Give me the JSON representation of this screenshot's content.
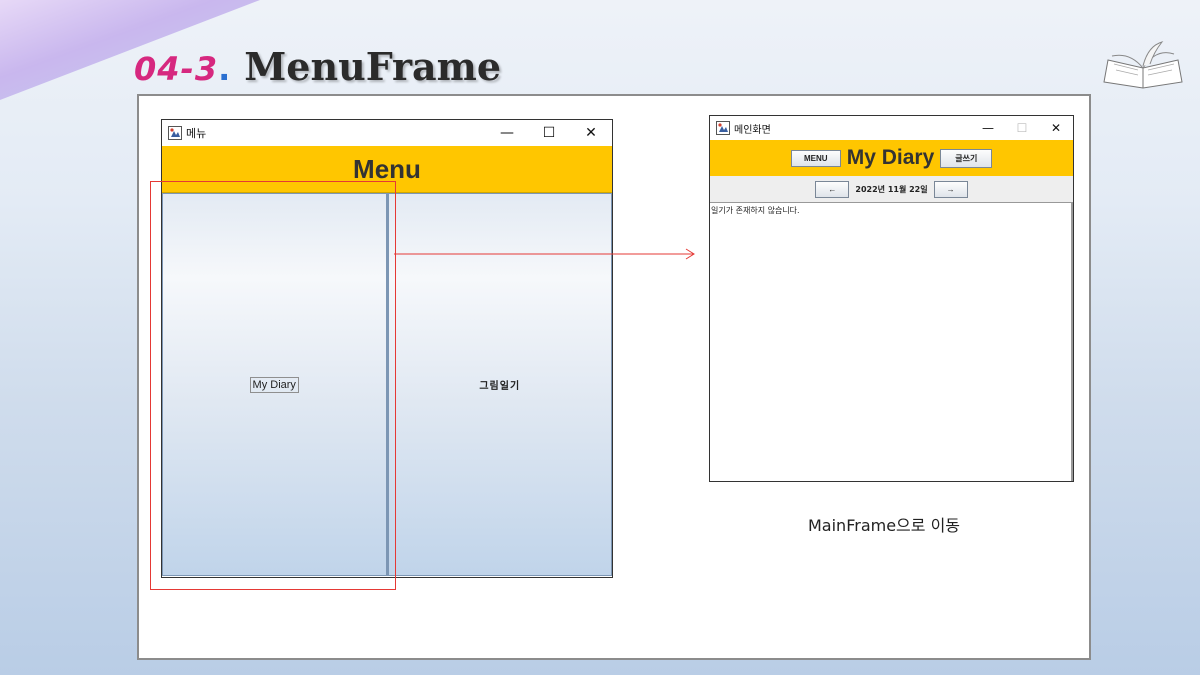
{
  "slide": {
    "number": "04-3",
    "dot": ".",
    "title": "MenuFrame"
  },
  "menu_window": {
    "title": "메뉴",
    "banner": "Menu",
    "left_button": "My Diary",
    "right_button": "그림일기",
    "controls": {
      "minimize": "—",
      "maximize": "☐",
      "close": "✕"
    }
  },
  "main_window": {
    "title": "메인화면",
    "menu_button": "MENU",
    "header_title": "My Diary",
    "write_button": "글쓰기",
    "prev_button": "←",
    "date": "2022년 11월 22일",
    "next_button": "→",
    "empty_message": "일기가 존재하지 않습니다.",
    "controls": {
      "minimize": "—",
      "maximize": "☐",
      "close": "✕"
    }
  },
  "caption": "MainFrame으로 이동",
  "colors": {
    "banner": "#ffc600",
    "title_number": "#d6287f",
    "highlight": "#e53935"
  },
  "icons": [
    "java-app-icon",
    "book-icon",
    "arrow-right-icon"
  ]
}
